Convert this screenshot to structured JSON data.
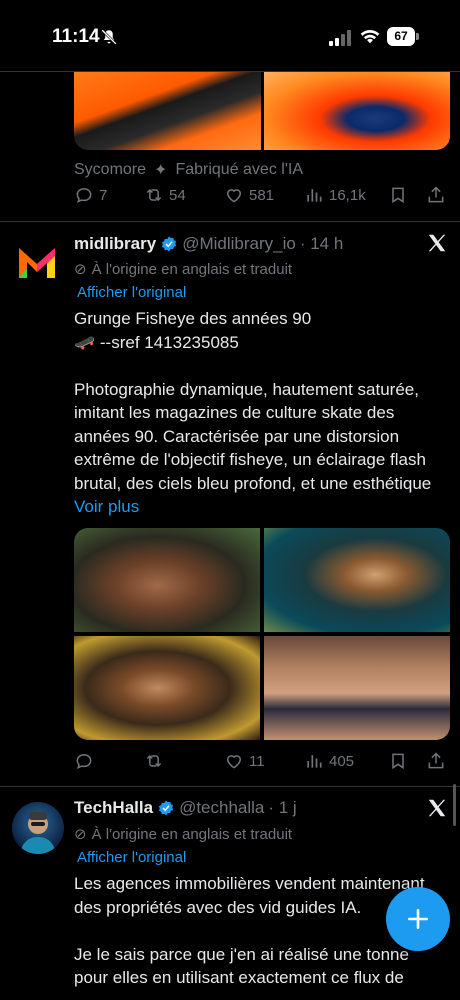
{
  "status_bar": {
    "time": "11:14",
    "battery": "67"
  },
  "prev_tweet": {
    "attribution": "Sycomore",
    "ai_label": "Fabriqué avec l'IA",
    "replies": "7",
    "reposts": "54",
    "likes": "581",
    "views": "16,1k"
  },
  "tweet1": {
    "name": "midlibrary",
    "handle": "@Midlibrary_io",
    "time": "· 14 h",
    "translated_note": "À l'origine en anglais et traduit",
    "show_original": "Afficher l'original",
    "text": "Grunge Fisheye des années 90\n🛹 --sref 1413235085\n\nPhotographie dynamique, hautement saturée, imitant les magazines de culture skate des années 90. Caractérisée par une distorsion extrême de l'objectif fisheye, un éclairage flash brutal, des ciels bleu profond, et une esthétique",
    "see_more": "Voir plus",
    "replies": "",
    "reposts": "",
    "likes": "11",
    "views": "405"
  },
  "tweet2": {
    "name": "TechHalla",
    "handle": "@techhalla",
    "time": "· 1 j",
    "translated_note": "À l'origine en anglais et traduit",
    "show_original": "Afficher l'original",
    "text": "Les agences immobilières vendent maintenant des propriétés avec des vid guides IA.\n\nJe le sais parce que j'en ai réalisé une tonne pour elles en utilisant exactement ce flux de"
  },
  "colors": {
    "accent": "#1d9bf0",
    "muted": "#71767b",
    "text": "#e7e9ea"
  }
}
